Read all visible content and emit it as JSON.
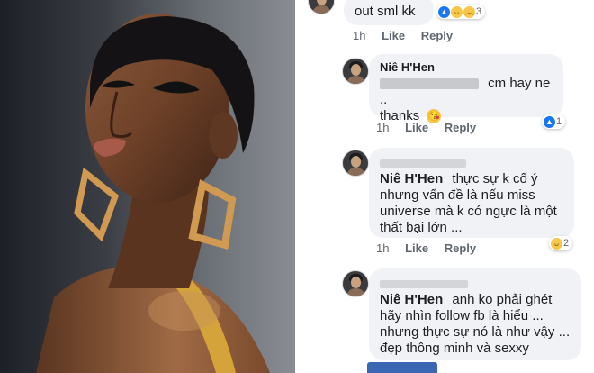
{
  "comments": [
    {
      "text": "out sml kk",
      "time": "1h",
      "like": "Like",
      "reply": "Reply",
      "reactions": {
        "icons": [
          "like-icon",
          "haha-icon",
          "sad-icon"
        ],
        "count": "3"
      }
    },
    {
      "author": "Niê H'Hen",
      "text_1": "cm hay ne ..",
      "text_2": "thanks",
      "emoji": "kiss-emoji",
      "time": "1h",
      "like": "Like",
      "reply": "Reply",
      "reactions": {
        "icons": [
          "like-icon"
        ],
        "count": "1"
      }
    },
    {
      "author": "Niê H'Hen",
      "text_1": "thực sự k cố ý",
      "text_2": "nhưng vấn đề là nếu miss",
      "text_3": "universe mà k có ngực là một",
      "text_4": "thất bại lớn ...",
      "time": "1h",
      "like": "Like",
      "reply": "Reply",
      "reactions": {
        "icons": [
          "haha-icon"
        ],
        "count": "2"
      }
    },
    {
      "author": "Niê H'Hen",
      "text_1": "anh ko phải ghét",
      "text_2": "hãy nhìn follow fb là hiểu ...",
      "text_3": "nhưng thực sự nó là như vậy ...",
      "text_4": "đẹp thông minh và sexxy"
    }
  ],
  "colors": {
    "bubble": "#f0f2f5",
    "text": "#1c1e21",
    "meta": "#606770",
    "like_blue": "#1877f2",
    "haha_yellow": "#f7c74a",
    "dress_gold": "#d4a43a",
    "earring_gold": "#d19a52"
  }
}
